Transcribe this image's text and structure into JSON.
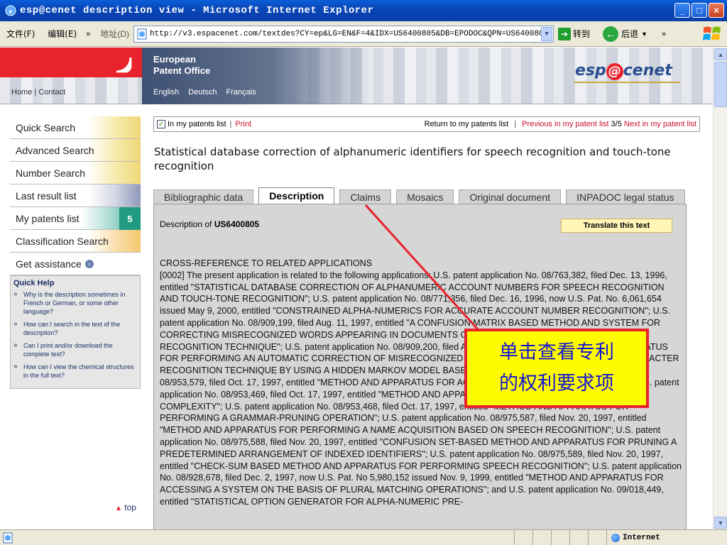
{
  "window": {
    "title": "esp@cenet description view - Microsoft Internet Explorer"
  },
  "toolbar": {
    "menu_file": "文件(F)",
    "menu_edit": "编辑(E)",
    "chevron": "»",
    "address_label": "地址(D)",
    "url": "http://v3.espacenet.com/textdes?CY=ep&LG=EN&F=4&IDX=US6400805&DB=EPODOC&QPN=US6400805",
    "go_label": "转到",
    "back_label": "后退"
  },
  "header": {
    "home_links": "Home | Contact",
    "office_line1": "European",
    "office_line2": "Patent Office",
    "languages": "English Deutsch Français",
    "brand_pre": "esp",
    "brand_at": "@",
    "brand_post": "cenet"
  },
  "nav": {
    "quick_search": "Quick Search",
    "advanced_search": "Advanced Search",
    "number_search": "Number Search",
    "last_result_list": "Last result list",
    "my_patents_list": "My patents list",
    "my_patents_count": "5",
    "classification_search": "Classification Search",
    "get_assistance": "Get assistance"
  },
  "quick_help": {
    "title": "Quick Help",
    "items": [
      "Why is the description sometimes in French or German, or some other language?",
      "How can I search in the text of the description?",
      "Can I print and/or download the complete text?",
      "How can I view the chemical structures in the full text?"
    ]
  },
  "top_link": "top",
  "actionbar": {
    "in_my_list": "In my patents list",
    "print": "Print",
    "return": "Return to my patents list",
    "previous": "Previous in my patent list",
    "position": "3/5",
    "next": "Next in my patent list"
  },
  "document": {
    "title": "Statistical database correction of alphanumeric identifiers for speech recognition and touch-tone recognition",
    "tabs": [
      "Bibliographic data",
      "Description",
      "Claims",
      "Mosaics",
      "Original document",
      "INPADOC legal status"
    ],
    "active_tab": "Description",
    "description_of_label": "Description of",
    "patent_number": "US6400805",
    "translate_label": "Translate this text",
    "section_heading": "CROSS-REFERENCE TO RELATED APPLICATIONS",
    "body_text": "[0002] The present application is related to the following applications: U.S. patent application No. 08/763,382, filed Dec. 13, 1996, entitled \"STATISTICAL DATABASE CORRECTION OF ALPHANUMERIC ACCOUNT NUMBERS FOR SPEECH RECOGNITION AND TOUCH-TONE RECOGNITION\"; U.S. patent application No. 08/771,356, filed Dec. 16, 1996, now U.S. Pat. No. 6,061,654 issued May 9, 2000, entitled \"CONSTRAINED ALPHA-NUMERICS FOR ACCURATE ACCOUNT NUMBER RECOGNITION\"; U.S. patent application No. 08/909,199, filed Aug. 11, 1997, entitled \"A CONFUSION MATRIX BASED METHOD AND SYSTEM FOR CORRECTING MISRECOGNIZED WORDS APPEARING IN DOCUMENTS GENERATED BY AN OPTICAL CHARACTER RECOGNITION TECHNIQUE\"; U.S. patent application No. 08/909,200, filed Aug. 11, 1997, entitled \"METHOD AND APPARATUS FOR PERFORMING AN AUTOMATIC CORRECTION OF MISRECOGNIZED WORDS PRODUCED BY AN OPTICAL CHARACTER RECOGNITION TECHNIQUE BY USING A HIDDEN MARKOV MODEL BASED ALGORITHM\"; U.S. patent application No. 08/953,579, filed Oct. 17, 1997, entitled \"METHOD AND APPARATUS FOR ACCESSING PRE-DEFINED GRAMMARS\"; U.S. patent application No. 08/953,469, filed Oct. 17, 1997, entitled \"METHOD AND APPARATUS FOR MINIMIZING GRAMMAR COMPLEXITY\"; U.S. patent application No. 08/953,468, filed Oct. 17, 1997, entitled \"METHOD AND APPARATUS FOR PERFORMING A GRAMMAR-PRUNING OPERATION\"; U.S. patent application No. 08/975,587, filed Nov. 20, 1997, entitled \"METHOD AND APPARATUS FOR PERFORMING A NAME ACQUISITION BASED ON SPEECH RECOGNITION\"; U.S. patent application No. 08/975,588, filed Nov. 20, 1997, entitled \"CONFUSION SET-BASED METHOD AND APPARATUS FOR PRUNING A PREDETERMINED ARRANGEMENT OF INDEXED IDENTIFIERS\"; U.S. patent application No. 08/975,589, filed Nov. 20, 1997, entitled \"CHECK-SUM BASED METHOD AND APPARATUS FOR PERFORMING SPEECH RECOGNITION\"; U.S. patent application No. 08/928,678, filed Dec. 2, 1997, now U.S. Pat. No 5,980,152 issued Nov. 9, 1999, entitled \"METHOD AND APPARATUS FOR ACCESSING A SYSTEM ON THE BASIS OF PLURAL MATCHING OPERATIONS\"; and U.S. patent application No. 09/018,449, entitled \"STATISTICAL OPTION GENERATOR FOR ALPHA-NUMERIC PRE-"
  },
  "annotation": {
    "line1": "单击查看专利",
    "line2": "的权利要求项",
    "color_border": "#e8232b",
    "color_fill": "#fffc00",
    "color_text": "#1414d6"
  },
  "statusbar": {
    "zone": "Internet"
  },
  "colors": {
    "epo_red": "#e8232b",
    "link_red": "#c8102e",
    "badge_teal": "#229a82",
    "xp_blue": "#0a5fd8"
  }
}
